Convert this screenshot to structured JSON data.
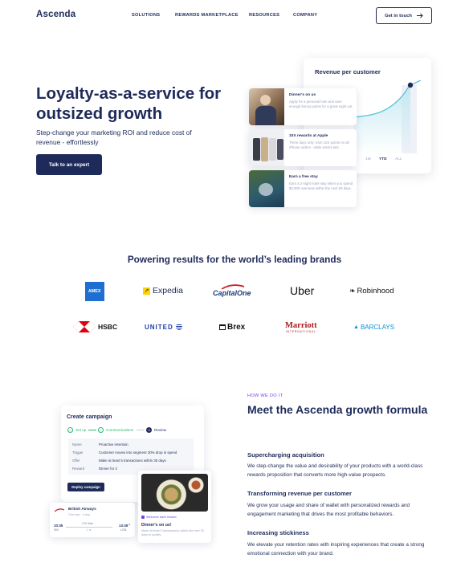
{
  "header": {
    "logo": "Ascenda",
    "nav": [
      "SOLUTIONS",
      "REWARDS MARKETPLACE",
      "RESOURCES",
      "COMPANY"
    ],
    "cta": "Get in touch",
    "cta_icon": "arrow-right-icon"
  },
  "hero": {
    "title": "Loyalty-as-a-service for outsized growth",
    "subtitle": "Step-change your marketing ROI and reduce cost of revenue - effortlessly",
    "button": "Talk to an expert"
  },
  "revenue_card": {
    "title": "Revenue per customer",
    "tabs": [
      "1M",
      "YTD",
      "ALL"
    ],
    "active_tab": "YTD",
    "offers": [
      {
        "title": "Dinner's on us",
        "desc": "Apply for a personal loan and earn enough bonus points for a great night out."
      },
      {
        "title": "10X rewards at Apple",
        "desc": "Three days only: earn 10X points on all iPhone orders - while stocks last."
      },
      {
        "title": "Earn a free stay",
        "desc": "Earn a 2-night hotel stay when you spend $3,000 overseas within the next 60 days."
      }
    ]
  },
  "brands": {
    "title": "Powering results for the world’s leading brands",
    "row1": [
      "AMEX",
      "Expedia",
      "CapitalOne",
      "Uber",
      "Robinhood"
    ],
    "row2": [
      "HSBC",
      "UNITED",
      "Brex",
      "Marriott",
      "BARCLAYS"
    ],
    "marriott_sub": "INTERNATIONAL",
    "colors": {
      "amex": "#1e6fcf",
      "hsbc": "#db0011",
      "united": "#1e3ea8",
      "marriott": "#b0191e",
      "barclays": "#0a8fd6",
      "capital_one": "#d0222c"
    }
  },
  "growth": {
    "eyebrow": "HOW WE DO IT",
    "title": "Meet the Ascenda growth formula",
    "features": [
      {
        "title": "Supercharging acquisition",
        "desc": "We step-change the value and desirability of your products with a world-class rewards proposition that converts more high-value prospects."
      },
      {
        "title": "Transforming revenue per customer",
        "desc": "We grow your usage and share of wallet with personalized rewards and engagement marketing that drives the most profitable behaviors."
      },
      {
        "title": "Increasing stickiness",
        "desc": "We elevate your retention rates with inspiring experiences that create a strong emotional connection with your brand."
      }
    ]
  },
  "campaign": {
    "title": "Create campaign",
    "steps": [
      "Set up",
      "Communications",
      "Review"
    ],
    "step3_num": "3",
    "rows": [
      {
        "k": "Name",
        "v": "Proactive retention"
      },
      {
        "k": "Trigger",
        "v": "Customer moves into segment 30% drop in spend"
      },
      {
        "k": "Offer",
        "v": "Make at least 5 transactions within 30 days"
      },
      {
        "k": "Reward",
        "v": "Dinner for 2"
      }
    ],
    "button": "Deploy campaign"
  },
  "flight": {
    "airline": "British Airways",
    "meta": "One way · 1 stop",
    "dep_time": "10:35",
    "dep_code": "SIN",
    "duration": "17h 10m",
    "stops": "1 st",
    "arr_time": "13:45",
    "arr_code": "LON",
    "arr_suffix": "+1"
  },
  "dinner_card": {
    "badge": "Welcome back reward",
    "title": "Dinner's on us!",
    "desc": "Make at least 5 transactions within the next 30 days to qualify."
  }
}
